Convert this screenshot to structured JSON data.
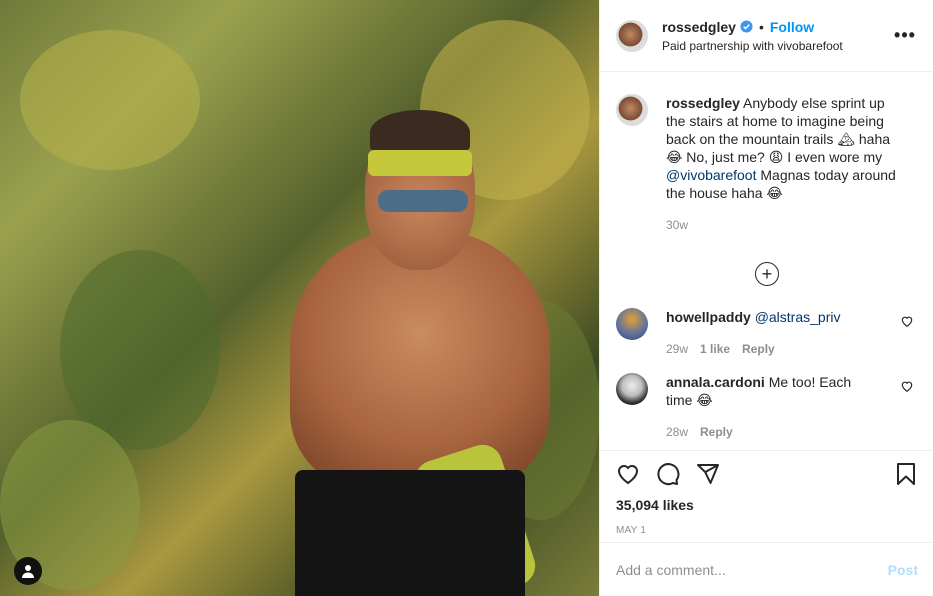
{
  "post": {
    "username": "rossedgley",
    "follow_label": "Follow",
    "dot": "•",
    "partnership": "Paid partnership with vivobarefoot",
    "more_label": "•••"
  },
  "caption": {
    "username": "rossedgley",
    "text_part1": " Anybody else sprint up the stairs at home to imagine being back on the mountain trails 🏔 haha 😂 No, just me? 😩 I even wore my ",
    "mention": "@vivobarefoot",
    "text_part2": " Magnas today around the house haha 😂",
    "time": "30w"
  },
  "load_more_label": "+",
  "comments": [
    {
      "username": "howellpaddy",
      "mention": "@alstras_priv",
      "text": "",
      "time": "29w",
      "likes": "1 like",
      "reply": "Reply"
    },
    {
      "username": "annala.cardoni",
      "mention": "",
      "text": " Me too! Each time 😂",
      "time": "28w",
      "likes": "",
      "reply": "Reply"
    }
  ],
  "stats": {
    "likes": "35,094 likes",
    "date": "MAY 1"
  },
  "compose": {
    "placeholder": "Add a comment...",
    "post_label": "Post"
  },
  "colors": {
    "accent": "#0095f6",
    "post_disabled": "#b2dffc",
    "muted": "#8e8e8e"
  }
}
